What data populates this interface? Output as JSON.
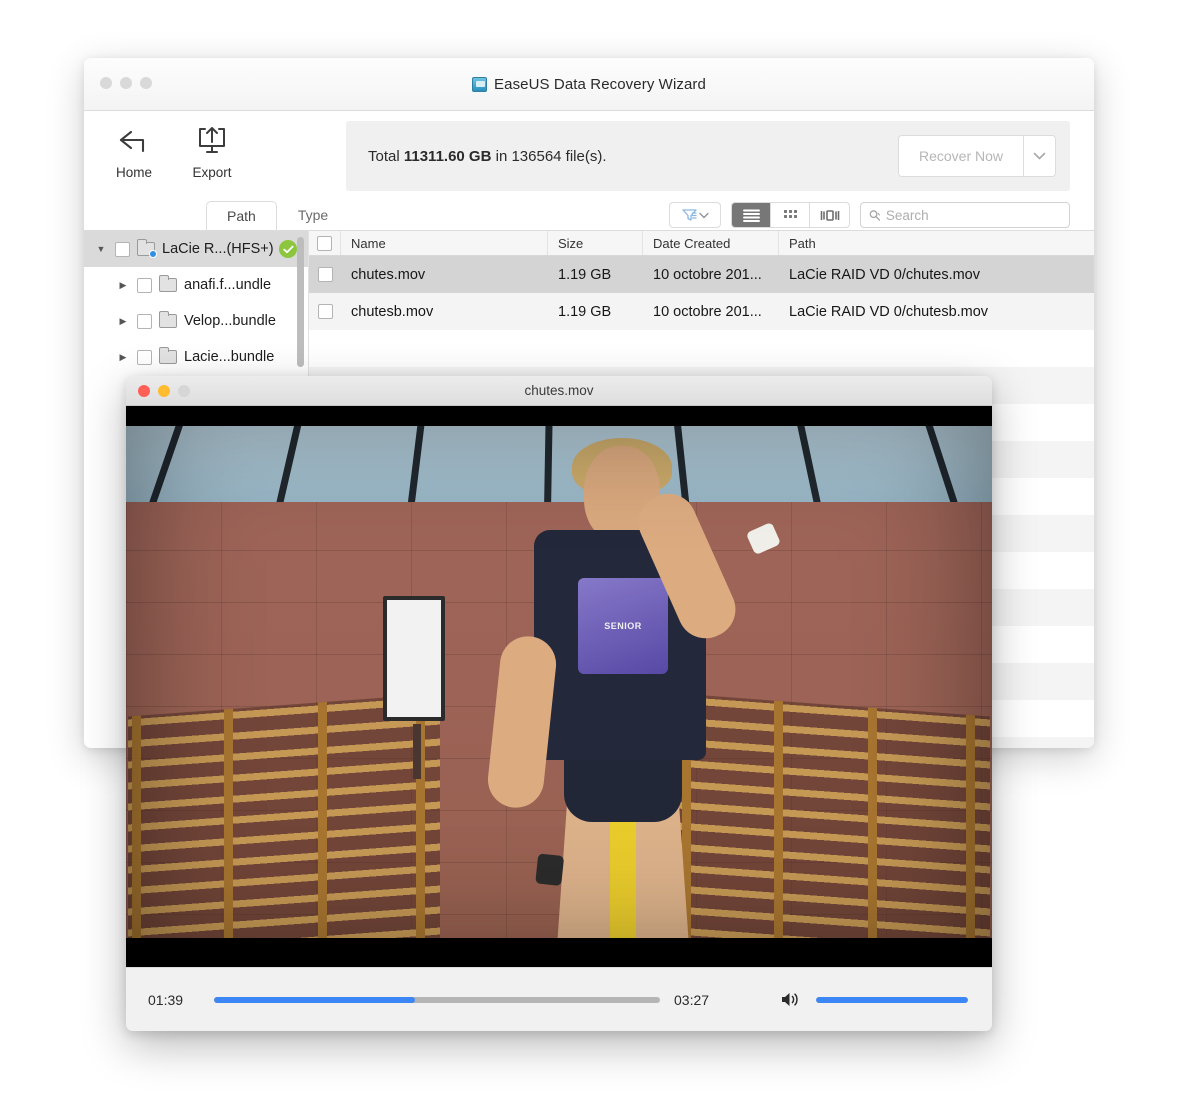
{
  "app_window": {
    "title": "EaseUS Data Recovery Wizard",
    "app_icon": "easeus-app-icon",
    "traffic_lights": [
      "close",
      "minimize",
      "zoom"
    ],
    "toolbar": {
      "buttons": [
        {
          "label": "Home",
          "icon": "back-arrow-icon"
        },
        {
          "label": "Export",
          "icon": "export-upload-icon"
        }
      ],
      "summary": {
        "prefix": "Total ",
        "size": "11311.60 GB",
        "middle": " in ",
        "count": "136564",
        "suffix": " file(s)."
      },
      "recover_button": {
        "label": "Recover Now",
        "enabled": false,
        "caret_icon": "chevron-down-icon"
      }
    },
    "tabs": [
      {
        "label": "Path",
        "active": true
      },
      {
        "label": "Type",
        "active": false
      }
    ],
    "list_tools": {
      "filter_icon": "filter-funnel-icon",
      "filter_caret_icon": "chevron-down-icon",
      "view_modes": [
        {
          "name": "list-view",
          "icon": "list-lines-icon",
          "active": true
        },
        {
          "name": "grid-view",
          "icon": "grid-dots-icon",
          "active": false
        },
        {
          "name": "coverflow-view",
          "icon": "coverflow-icon",
          "active": false
        }
      ],
      "search": {
        "placeholder": "Search",
        "value": "",
        "icon": "search-magnifier-icon"
      }
    },
    "sidebar": {
      "items": [
        {
          "label": "LaCie R...(HFS+)",
          "depth": 0,
          "expanded": true,
          "checked": false,
          "selected": true,
          "badge": "verified-check"
        },
        {
          "label": "anafi.f...undle",
          "depth": 1,
          "expanded": false,
          "checked": false,
          "selected": false
        },
        {
          "label": "Velop...bundle",
          "depth": 1,
          "expanded": false,
          "checked": false,
          "selected": false
        },
        {
          "label": "Lacie...bundle",
          "depth": 1,
          "expanded": false,
          "checked": false,
          "selected": false
        }
      ]
    },
    "file_list": {
      "columns": [
        "Name",
        "Size",
        "Date Created",
        "Path"
      ],
      "rows": [
        {
          "name": "chutes.mov",
          "size": "1.19 GB",
          "date": "10 octobre 201...",
          "path": "LaCie RAID VD 0/chutes.mov",
          "selected": true,
          "checked": false
        },
        {
          "name": "chutesb.mov",
          "size": "1.19 GB",
          "date": "10 octobre 201...",
          "path": "LaCie RAID VD 0/chutesb.mov",
          "selected": false,
          "checked": false
        }
      ]
    }
  },
  "player_window": {
    "title": "chutes.mov",
    "traffic_lights": [
      {
        "name": "close",
        "color": "#ff5f57"
      },
      {
        "name": "minimize",
        "color": "#febc2e"
      },
      {
        "name": "zoom",
        "color": "#d6d6d6"
      }
    ],
    "video": {
      "scene_description": "person in dark t-shirt in gymnasium with brick wall and wooden wall bars",
      "shirt_text": "SENIOR"
    },
    "controls": {
      "current_time": "01:39",
      "total_time": "03:27",
      "progress_percent": 45,
      "volume_percent": 100,
      "volume_icon": "speaker-volume-icon",
      "accent_color": "#3d86f5"
    }
  }
}
